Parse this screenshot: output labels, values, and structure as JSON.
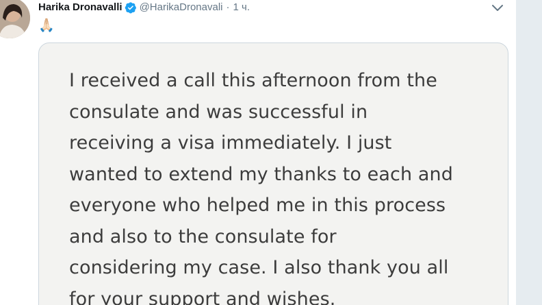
{
  "tweet": {
    "display_name": "Harika Dronavalli",
    "handle": "@HarikaDronavali",
    "separator": "·",
    "time": "1 ч.",
    "emoji": "🙏🏻",
    "icons": {
      "avatar": "avatar-photo",
      "verified": "verified-badge-icon",
      "menu": "chevron-down-icon"
    },
    "colors": {
      "name": "#14171a",
      "meta": "#657786",
      "verified": "#1da1f2"
    }
  },
  "media": {
    "lines": [
      "I received a call this afternoon from the",
      "consulate and was successful in",
      "receiving a visa immediately. I just",
      "wanted to extend my thanks to each and",
      "everyone who helped me in this process",
      "and also to the consulate for",
      "considering my case. I also thank you all",
      "for your support and wishes."
    ]
  }
}
